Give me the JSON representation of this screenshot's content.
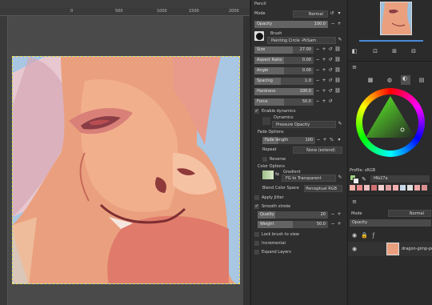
{
  "rulers": {
    "top": [
      "0",
      "500",
      "1000",
      "1500",
      "2000"
    ],
    "left": [
      "5",
      "1",
      "5",
      "1",
      "5",
      "2"
    ]
  },
  "tool_options": {
    "title": "Pencil",
    "mode_label": "Mode",
    "mode_value": "Normal",
    "opacity_label": "Opacity",
    "opacity_value": "100.0",
    "brush_label": "Brush",
    "brush_value": "Painting Circle -PkSam",
    "size_label": "Size",
    "size_value": "27.00",
    "aspect_label": "Aspect Ratio",
    "aspect_value": "0.00",
    "angle_label": "Angle",
    "angle_value": "0.00",
    "spacing_label": "Spacing",
    "spacing_value": "1.0",
    "hardness_label": "Hardness",
    "hardness_value": "100.0",
    "force_label": "Force",
    "force_value": "50.0",
    "enable_dynamics": "Enable dynamics",
    "dynamics_label": "Dynamics",
    "dynamics_value": "Pressure Opacity",
    "fade_options": "Fade Options",
    "fade_length_label": "Fade length",
    "fade_length_value": "100",
    "fade_unit": "%",
    "repeat_label": "Repeat",
    "repeat_value": "None (extend)",
    "reverse_label": "Reverse",
    "color_options": "Color Options",
    "gradient_label": "Gradient",
    "gradient_value": "FG to Transparent",
    "blend_label": "Blend Color Space",
    "blend_value": "Perceptual RGB",
    "apply_jitter": "Apply Jitter",
    "smooth_stroke": "Smooth stroke",
    "quality_label": "Quality",
    "quality_value": "20",
    "weight_label": "Weight",
    "weight_value": "50.0",
    "lock_brush": "Lock brush to view",
    "incremental": "Incremental",
    "expand_layers": "Expand Layers"
  },
  "right_dock": {
    "profile_label": "Profile: sRGB",
    "hex_value": "f4b27a",
    "layers_mode_label": "Mode",
    "layers_mode_value": "Normal",
    "layers_opacity_label": "Opacity",
    "layer_name": "dragon-gimp-pract"
  },
  "palette": [
    "#f4b2a8",
    "#e98a8a",
    "#f0c0c0",
    "#d07070",
    "#f6d0d0",
    "#e0a0a0",
    "#f4b0b0",
    "#c8d8e8",
    "#e0e0e0",
    "#f0a8a8",
    "#d89090",
    "#f8c8c8"
  ],
  "colors": {
    "fg": "#f4b27a",
    "accent": "#4a8ad8"
  }
}
